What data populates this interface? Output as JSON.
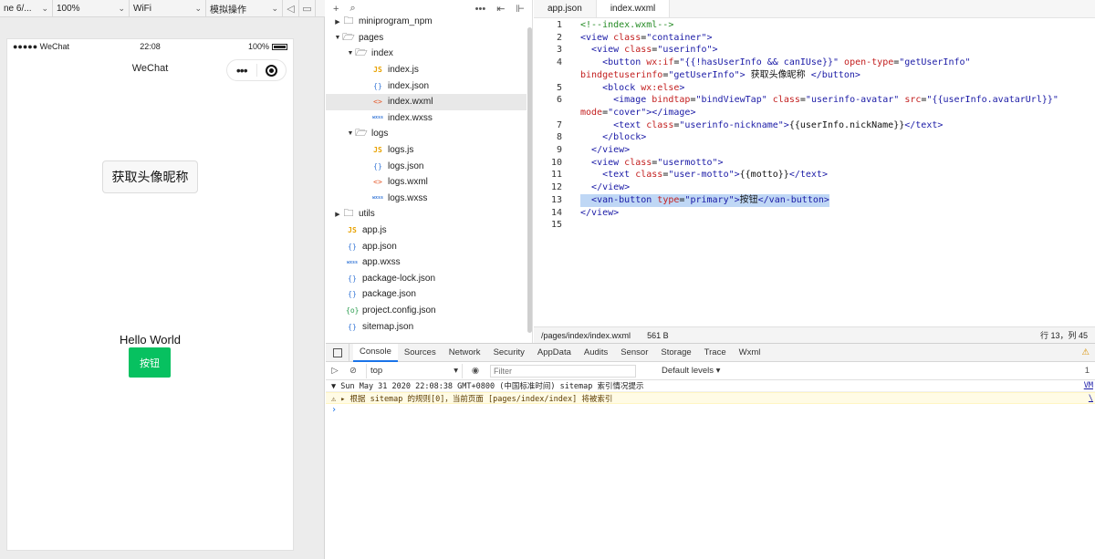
{
  "simulator": {
    "toolbar": {
      "device": "ne 6/...",
      "zoom": "100%",
      "network": "WiFi",
      "operation": "模拟操作"
    },
    "statusbar": {
      "carrier": "●●●●● WeChat",
      "time": "22:08",
      "battery": "100%"
    },
    "navbar": {
      "title": "WeChat",
      "menu_glyph": "•••"
    },
    "page": {
      "get_user_button": "获取头像昵称",
      "motto": "Hello World",
      "van_button": "按钮",
      "van_button_color": "#07c160"
    }
  },
  "explorer": {
    "rows": [
      {
        "name": "miniprogram_npm",
        "type": "folder",
        "expanded": false,
        "depth": 0
      },
      {
        "name": "pages",
        "type": "folder",
        "expanded": true,
        "depth": 0
      },
      {
        "name": "index",
        "type": "folder",
        "expanded": true,
        "depth": 1
      },
      {
        "name": "index.js",
        "type": "js",
        "icon": "JS",
        "depth": 2
      },
      {
        "name": "index.json",
        "type": "json",
        "icon": "{}",
        "depth": 2
      },
      {
        "name": "index.wxml",
        "type": "wxml",
        "icon": "<>",
        "depth": 2,
        "selected": true
      },
      {
        "name": "index.wxss",
        "type": "wxss",
        "icon": "wxss",
        "depth": 2
      },
      {
        "name": "logs",
        "type": "folder",
        "expanded": true,
        "depth": 1
      },
      {
        "name": "logs.js",
        "type": "js",
        "icon": "JS",
        "depth": 2
      },
      {
        "name": "logs.json",
        "type": "json",
        "icon": "{}",
        "depth": 2
      },
      {
        "name": "logs.wxml",
        "type": "wxml",
        "icon": "<>",
        "depth": 2
      },
      {
        "name": "logs.wxss",
        "type": "wxss",
        "icon": "wxss",
        "depth": 2
      },
      {
        "name": "utils",
        "type": "folder",
        "expanded": false,
        "depth": 0
      },
      {
        "name": "app.js",
        "type": "js",
        "icon": "JS",
        "depth": 0
      },
      {
        "name": "app.json",
        "type": "json",
        "icon": "{}",
        "depth": 0
      },
      {
        "name": "app.wxss",
        "type": "wxss",
        "icon": "wxss",
        "depth": 0
      },
      {
        "name": "package-lock.json",
        "type": "json",
        "icon": "{}",
        "depth": 0
      },
      {
        "name": "package.json",
        "type": "json",
        "icon": "{}",
        "depth": 0
      },
      {
        "name": "project.config.json",
        "type": "config",
        "icon": "{o}",
        "depth": 0
      },
      {
        "name": "sitemap.json",
        "type": "json",
        "icon": "{}",
        "depth": 0
      }
    ]
  },
  "editor": {
    "tabs": [
      {
        "label": "app.json",
        "active": false
      },
      {
        "label": "index.wxml",
        "active": true
      }
    ],
    "lines": [
      [
        [
          "com",
          "<!--index.wxml-->"
        ]
      ],
      [
        [
          "tag",
          "<view "
        ],
        [
          "attr",
          "class"
        ],
        [
          "text",
          "="
        ],
        [
          "val",
          "\"container\""
        ],
        [
          "tag",
          ">"
        ]
      ],
      [
        [
          "text",
          "  "
        ],
        [
          "tag",
          "<view "
        ],
        [
          "attr",
          "class"
        ],
        [
          "text",
          "="
        ],
        [
          "val",
          "\"userinfo\""
        ],
        [
          "tag",
          ">"
        ]
      ],
      [
        [
          "text",
          "    "
        ],
        [
          "tag",
          "<button "
        ],
        [
          "attr",
          "wx:if"
        ],
        [
          "text",
          "="
        ],
        [
          "val",
          "\"{{!hasUserInfo && canIUse}}\""
        ],
        [
          "text",
          " "
        ],
        [
          "attr",
          "open-type"
        ],
        [
          "text",
          "="
        ],
        [
          "val",
          "\"getUserInfo\""
        ]
      ],
      [
        [
          "attr",
          "bindgetuserinfo"
        ],
        [
          "text",
          "="
        ],
        [
          "val",
          "\"getUserInfo\""
        ],
        [
          "tag",
          ">"
        ],
        [
          "text",
          " 获取头像昵称 "
        ],
        [
          "tag",
          "</button>"
        ]
      ],
      [
        [
          "text",
          "    "
        ],
        [
          "tag",
          "<block "
        ],
        [
          "attr",
          "wx:else"
        ],
        [
          "tag",
          ">"
        ]
      ],
      [
        [
          "text",
          "      "
        ],
        [
          "tag",
          "<image "
        ],
        [
          "attr",
          "bindtap"
        ],
        [
          "text",
          "="
        ],
        [
          "val",
          "\"bindViewTap\""
        ],
        [
          "text",
          " "
        ],
        [
          "attr",
          "class"
        ],
        [
          "text",
          "="
        ],
        [
          "val",
          "\"userinfo-avatar\""
        ],
        [
          "text",
          " "
        ],
        [
          "attr",
          "src"
        ],
        [
          "text",
          "="
        ],
        [
          "val",
          "\"{{userInfo.avatarUrl}}\""
        ]
      ],
      [
        [
          "attr",
          "mode"
        ],
        [
          "text",
          "="
        ],
        [
          "val",
          "\"cover\""
        ],
        [
          "tag",
          "></image>"
        ]
      ],
      [
        [
          "text",
          "      "
        ],
        [
          "tag",
          "<text "
        ],
        [
          "attr",
          "class"
        ],
        [
          "text",
          "="
        ],
        [
          "val",
          "\"userinfo-nickname\""
        ],
        [
          "tag",
          ">"
        ],
        [
          "text",
          "{{userInfo.nickName}}"
        ],
        [
          "tag",
          "</text>"
        ]
      ],
      [
        [
          "text",
          "    "
        ],
        [
          "tag",
          "</block>"
        ]
      ],
      [
        [
          "text",
          "  "
        ],
        [
          "tag",
          "</view>"
        ]
      ],
      [
        [
          "text",
          "  "
        ],
        [
          "tag",
          "<view "
        ],
        [
          "attr",
          "class"
        ],
        [
          "text",
          "="
        ],
        [
          "val",
          "\"usermotto\""
        ],
        [
          "tag",
          ">"
        ]
      ],
      [
        [
          "text",
          "    "
        ],
        [
          "tag",
          "<text "
        ],
        [
          "attr",
          "class"
        ],
        [
          "text",
          "="
        ],
        [
          "val",
          "\"user-motto\""
        ],
        [
          "tag",
          ">"
        ],
        [
          "text",
          "{{motto}}"
        ],
        [
          "tag",
          "</text>"
        ]
      ],
      [
        [
          "text",
          "  "
        ],
        [
          "tag",
          "</view>"
        ]
      ],
      [
        [
          "text",
          "  "
        ],
        [
          "tag",
          "<van-button "
        ],
        [
          "attr",
          "type"
        ],
        [
          "text",
          "="
        ],
        [
          "val",
          "\"primary\""
        ],
        [
          "tag",
          ">"
        ],
        [
          "text",
          "按钮"
        ],
        [
          "tag",
          "</van-button>"
        ]
      ],
      [
        [
          "tag",
          "</view>"
        ]
      ],
      []
    ],
    "line_numbers": [
      "1",
      "2",
      "3",
      "4",
      "",
      "5",
      "6",
      "",
      "7",
      "8",
      "9",
      "10",
      "11",
      "12",
      "13",
      "14",
      "15"
    ],
    "highlight_row": 14,
    "status": {
      "path": "/pages/index/index.wxml",
      "size": "561 B",
      "cursor": "行 13，列 45"
    }
  },
  "devtools": {
    "tabs": [
      "Console",
      "Sources",
      "Network",
      "Security",
      "AppData",
      "Audits",
      "Sensor",
      "Storage",
      "Trace",
      "Wxml"
    ],
    "active_tab": "Console",
    "warn_indicator": "⚠",
    "context": "top",
    "filter_placeholder": "Filter",
    "levels": "Default levels ▾",
    "right_count": "1",
    "messages": [
      {
        "level": "info",
        "text": "▼ Sun May 31 2020 22:08:38 GMT+0800 (中国标准时间) sitemap 索引情况提示",
        "source": "VM"
      },
      {
        "level": "warn",
        "text": "⚠ ▸ 根据 sitemap 的规则[0]，当前页面 [pages/index/index] 将被索引",
        "source": "\\"
      }
    ],
    "prompt": "›"
  }
}
